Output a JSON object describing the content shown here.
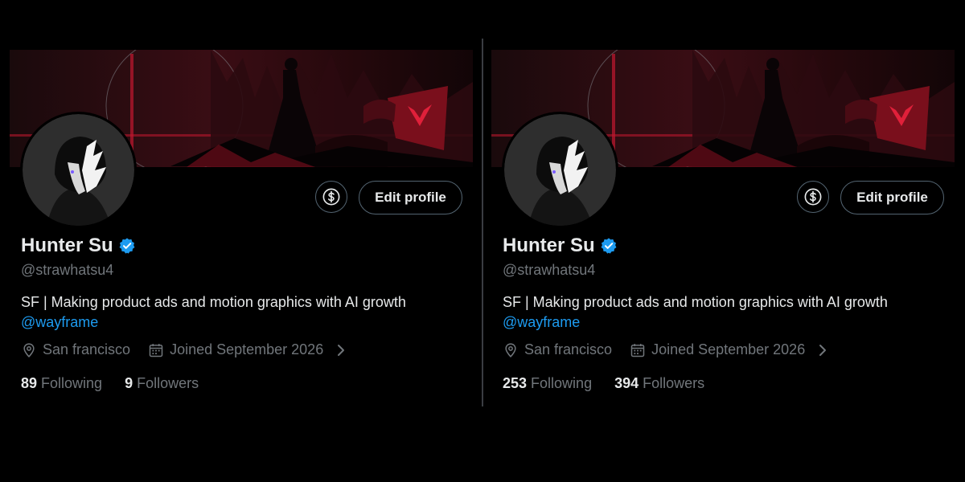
{
  "colors": {
    "background": "#000000",
    "text_primary": "#e7e9ea",
    "text_secondary": "#71767b",
    "link": "#1d9bf0",
    "verified_badge": "#1d9bf0",
    "button_border": "#536471",
    "banner_accent": "#b3142a"
  },
  "icons": {
    "verified": "verified-badge-icon",
    "tip": "dollar-sign-icon",
    "location": "map-pin-icon",
    "joined": "calendar-icon",
    "more": "chevron-right-icon"
  },
  "profiles": [
    {
      "edit_button": "Edit profile",
      "name": "Hunter Su",
      "handle": "@strawhatsu4",
      "bio_text": "SF | Making product ads and motion graphics with AI growth ",
      "bio_mention": "@wayframe",
      "location": "San francisco",
      "joined": "Joined September 2026",
      "following_count": "89",
      "following_label": "Following",
      "followers_count": "9",
      "followers_label": "Followers"
    },
    {
      "edit_button": "Edit profile",
      "name": "Hunter Su",
      "handle": "@strawhatsu4",
      "bio_text": "SF | Making product ads and motion graphics with AI growth ",
      "bio_mention": "@wayframe",
      "location": "San francisco",
      "joined": "Joined September 2026",
      "following_count": "253",
      "following_label": "Following",
      "followers_count": "394",
      "followers_label": "Followers"
    }
  ]
}
